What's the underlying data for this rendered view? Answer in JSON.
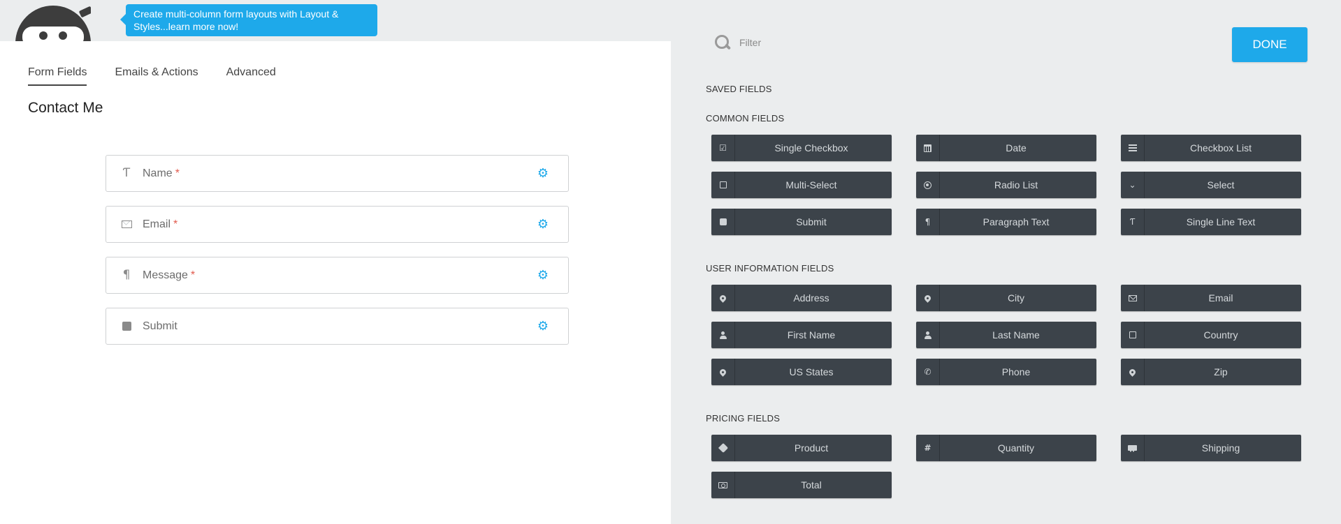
{
  "tooltip": {
    "text": "Create multi-column form layouts with Layout & Styles...learn more now!"
  },
  "builder": {
    "tabs": [
      {
        "label": "Form Fields"
      },
      {
        "label": "Emails & Actions"
      },
      {
        "label": "Advanced"
      }
    ],
    "form_title": "Contact Me",
    "fields": [
      {
        "label": "Name",
        "required_mark": "*",
        "icon": "text-cursor-icon"
      },
      {
        "label": "Email",
        "required_mark": "*",
        "icon": "envelope-icon"
      },
      {
        "label": "Message",
        "required_mark": "*",
        "icon": "paragraph-icon"
      },
      {
        "label": "Submit",
        "required_mark": "",
        "icon": "square-icon"
      }
    ]
  },
  "drawer": {
    "filter_placeholder": "Filter",
    "done_label": "DONE",
    "sections": {
      "saved": "SAVED FIELDS",
      "common": "COMMON FIELDS",
      "user": "USER INFORMATION FIELDS",
      "pricing": "PRICING FIELDS"
    },
    "common_fields": [
      {
        "label": "Single Checkbox",
        "icon": "checkbox-checked-icon"
      },
      {
        "label": "Date",
        "icon": "calendar-icon"
      },
      {
        "label": "Checkbox List",
        "icon": "list-icon"
      },
      {
        "label": "Multi-Select",
        "icon": "square-outline-icon"
      },
      {
        "label": "Radio List",
        "icon": "radio-icon"
      },
      {
        "label": "Select",
        "icon": "chevron-down-icon"
      },
      {
        "label": "Submit",
        "icon": "square-filled-icon"
      },
      {
        "label": "Paragraph Text",
        "icon": "paragraph-icon"
      },
      {
        "label": "Single Line Text",
        "icon": "text-cursor-icon"
      }
    ],
    "user_fields": [
      {
        "label": "Address",
        "icon": "map-pin-icon"
      },
      {
        "label": "City",
        "icon": "map-pin-icon"
      },
      {
        "label": "Email",
        "icon": "envelope-icon"
      },
      {
        "label": "First Name",
        "icon": "user-icon"
      },
      {
        "label": "Last Name",
        "icon": "user-icon"
      },
      {
        "label": "Country",
        "icon": "square-outline-icon"
      },
      {
        "label": "US States",
        "icon": "map-pin-icon"
      },
      {
        "label": "Phone",
        "icon": "phone-icon"
      },
      {
        "label": "Zip",
        "icon": "map-pin-icon"
      }
    ],
    "pricing_fields": [
      {
        "label": "Product",
        "icon": "tag-icon"
      },
      {
        "label": "Quantity",
        "icon": "hash-icon"
      },
      {
        "label": "Shipping",
        "icon": "truck-icon"
      },
      {
        "label": "Total",
        "icon": "money-icon"
      }
    ]
  },
  "colors": {
    "accent": "#1ea9ea",
    "field_button": "#3c434a",
    "required": "#e25b4e"
  }
}
